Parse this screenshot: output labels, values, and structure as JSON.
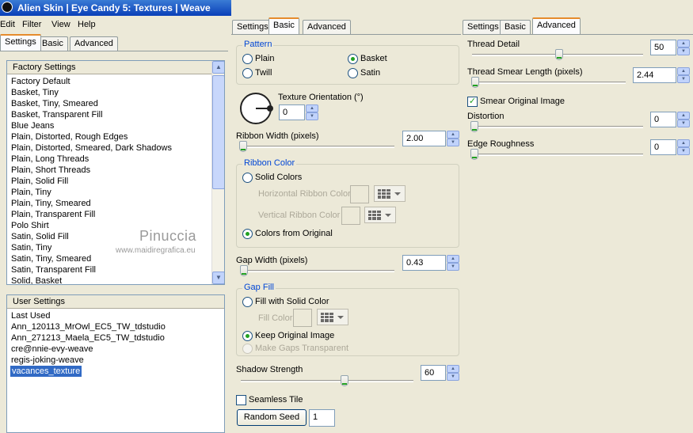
{
  "title": "Alien Skin  |  Eye Candy 5: Textures  |  Weave",
  "menu": [
    "Edit",
    "Filter",
    "View",
    "Help"
  ],
  "left_tabs": [
    "Settings",
    "Basic",
    "Advanced"
  ],
  "factory": {
    "header": "Factory Settings",
    "items": [
      "Factory Default",
      "Basket, Tiny",
      "Basket, Tiny, Smeared",
      "Basket, Transparent Fill",
      "Blue Jeans",
      "Plain, Distorted, Rough Edges",
      "Plain, Distorted, Smeared, Dark Shadows",
      "Plain, Long Threads",
      "Plain, Short Threads",
      "Plain, Solid Fill",
      "Plain, Tiny",
      "Plain, Tiny, Smeared",
      "Plain, Transparent Fill",
      "Polo Shirt",
      "Satin, Solid Fill",
      "Satin, Tiny",
      "Satin, Tiny, Smeared",
      "Satin, Transparent Fill",
      "Solid, Basket"
    ]
  },
  "user": {
    "header": "User Settings",
    "items": [
      "Last Used",
      "Ann_120113_MrOwl_EC5_TW_tdstudio",
      "Ann_271213_Maela_EC5_TW_tdstudio",
      "cre@nnie-evy-weave",
      "regis-joking-weave",
      "vacances_texture"
    ],
    "selected": "vacances_texture"
  },
  "watermark": {
    "name": "Pinuccia",
    "url": "www.maidiregrafica.eu"
  },
  "mid_tabs": [
    "Settings",
    "Basic",
    "Advanced"
  ],
  "basic": {
    "pattern_label": "Pattern",
    "pattern_options": [
      "Plain",
      "Basket",
      "Twill",
      "Satin"
    ],
    "pattern_selected": "Basket",
    "texture_orientation_label": "Texture Orientation (°)",
    "texture_orientation": "0",
    "ribbon_width_label": "Ribbon Width (pixels)",
    "ribbon_width": "2.00",
    "ribbon_color_label": "Ribbon Color",
    "solid_colors": "Solid Colors",
    "horizontal_ribbon_color": "Horizontal Ribbon Color",
    "vertical_ribbon_color": "Vertical Ribbon Color",
    "colors_from_original": "Colors from Original",
    "ribbon_color_selected": "Colors from Original",
    "gap_width_label": "Gap Width (pixels)",
    "gap_width": "0.43",
    "gap_fill_label": "Gap Fill",
    "fill_with_solid_color": "Fill with Solid Color",
    "fill_color": "Fill Color",
    "keep_original_image": "Keep Original Image",
    "make_gaps_transparent": "Make Gaps Transparent",
    "gap_fill_selected": "Keep Original Image",
    "shadow_strength_label": "Shadow Strength",
    "shadow_strength": "60",
    "seamless_tile": "Seamless Tile",
    "seamless_tile_checked": false,
    "random_seed_button": "Random Seed",
    "random_seed": "1"
  },
  "right_tabs": [
    "Settings",
    "Basic",
    "Advanced"
  ],
  "advanced": {
    "thread_detail_label": "Thread Detail",
    "thread_detail": "50",
    "thread_smear_label": "Thread Smear Length (pixels)",
    "thread_smear": "2.44",
    "smear_original_image": "Smear Original Image",
    "smear_original_checked": true,
    "distortion_label": "Distortion",
    "distortion": "0",
    "edge_roughness_label": "Edge Roughness",
    "edge_roughness": "0"
  },
  "colors": {
    "accent": "#316ac5",
    "group_label": "#0046d5",
    "tab_highlight": "#e68b2c"
  }
}
